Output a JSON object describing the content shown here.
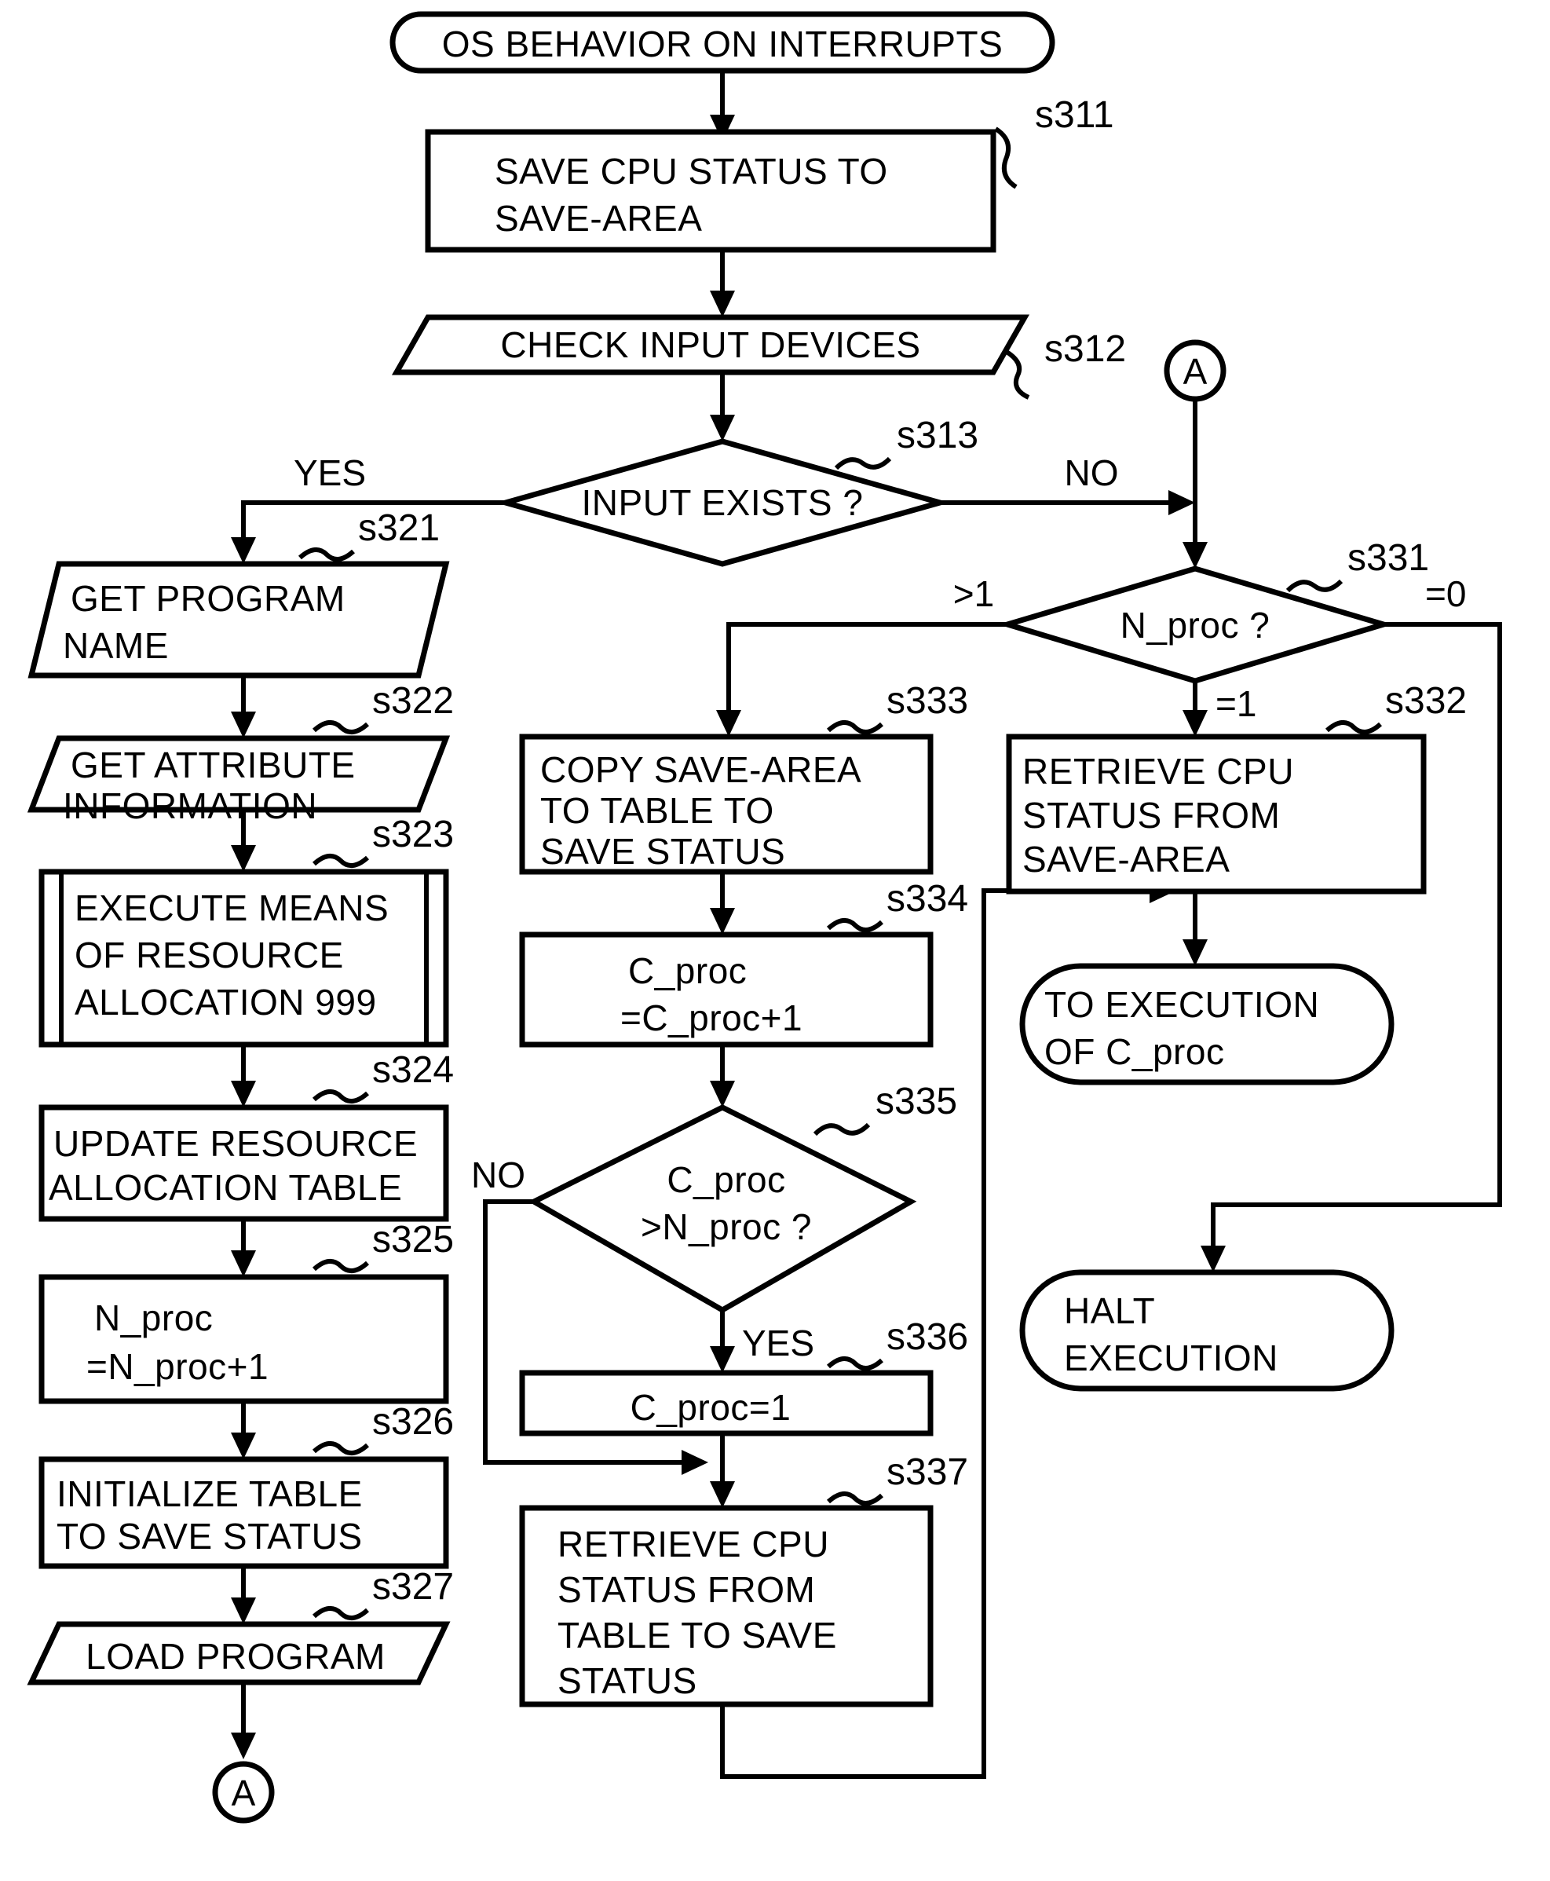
{
  "diagram": {
    "title": "OS BEHAVIOR ON INTERRUPTS",
    "type": "flowchart"
  },
  "nodes": {
    "start": {
      "label": "OS BEHAVIOR ON INTERRUPTS",
      "shape": "terminator"
    },
    "s311": {
      "step": "s311",
      "shape": "process",
      "lines": [
        "SAVE CPU STATUS TO",
        "SAVE-AREA"
      ]
    },
    "s312": {
      "step": "s312",
      "shape": "input-output",
      "lines": [
        "CHECK INPUT DEVICES"
      ]
    },
    "s313": {
      "step": "s313",
      "shape": "decision",
      "lines": [
        "INPUT EXISTS ?"
      ]
    },
    "s321": {
      "step": "s321",
      "shape": "input-output",
      "lines": [
        "GET PROGRAM",
        "NAME"
      ]
    },
    "s322": {
      "step": "s322",
      "shape": "input-output",
      "lines": [
        "GET ATTRIBUTE",
        "INFORMATION"
      ]
    },
    "s323": {
      "step": "s323",
      "shape": "predefined-process",
      "lines": [
        "EXECUTE MEANS",
        "OF RESOURCE",
        "ALLOCATION 999"
      ]
    },
    "s324": {
      "step": "s324",
      "shape": "process",
      "lines": [
        "UPDATE RESOURCE",
        "ALLOCATION TABLE"
      ]
    },
    "s325": {
      "step": "s325",
      "shape": "process",
      "lines": [
        "N_proc",
        "=N_proc+1"
      ]
    },
    "s326": {
      "step": "s326",
      "shape": "process",
      "lines": [
        "INITIALIZE TABLE",
        "TO SAVE STATUS"
      ]
    },
    "s327": {
      "step": "s327",
      "shape": "input-output",
      "lines": [
        "LOAD PROGRAM"
      ]
    },
    "s331": {
      "step": "s331",
      "shape": "decision",
      "lines": [
        "N_proc ?"
      ]
    },
    "s332": {
      "step": "s332",
      "shape": "process",
      "lines": [
        "RETRIEVE CPU",
        "STATUS FROM",
        "SAVE-AREA"
      ]
    },
    "s333": {
      "step": "s333",
      "shape": "process",
      "lines": [
        "COPY SAVE-AREA",
        "TO TABLE TO",
        "SAVE STATUS"
      ]
    },
    "s334": {
      "step": "s334",
      "shape": "process",
      "lines": [
        "C_proc",
        "=C_proc+1"
      ]
    },
    "s335": {
      "step": "s335",
      "shape": "decision",
      "lines": [
        "C_proc",
        ">N_proc ?"
      ]
    },
    "s336": {
      "step": "s336",
      "shape": "process",
      "lines": [
        "C_proc=1"
      ]
    },
    "s337": {
      "step": "s337",
      "shape": "process",
      "lines": [
        "RETRIEVE CPU",
        "STATUS FROM",
        "TABLE TO SAVE",
        "STATUS"
      ]
    },
    "to_exec": {
      "shape": "terminator",
      "lines": [
        "TO EXECUTION",
        "OF C_proc"
      ]
    },
    "halt": {
      "shape": "terminator",
      "lines": [
        "HALT",
        "EXECUTION"
      ]
    },
    "connector_a_right": {
      "label": "A",
      "shape": "connector"
    },
    "connector_a_bottom": {
      "label": "A",
      "shape": "connector"
    }
  },
  "edge_labels": {
    "s313_yes": "YES",
    "s313_no": "NO",
    "s331_gt1": ">1",
    "s331_eq1": "=1",
    "s331_eq0": "=0",
    "s335_no": "NO",
    "s335_yes": "YES"
  },
  "colors": {
    "stroke": "#000000",
    "fill": "#ffffff",
    "background": "#ffffff"
  }
}
